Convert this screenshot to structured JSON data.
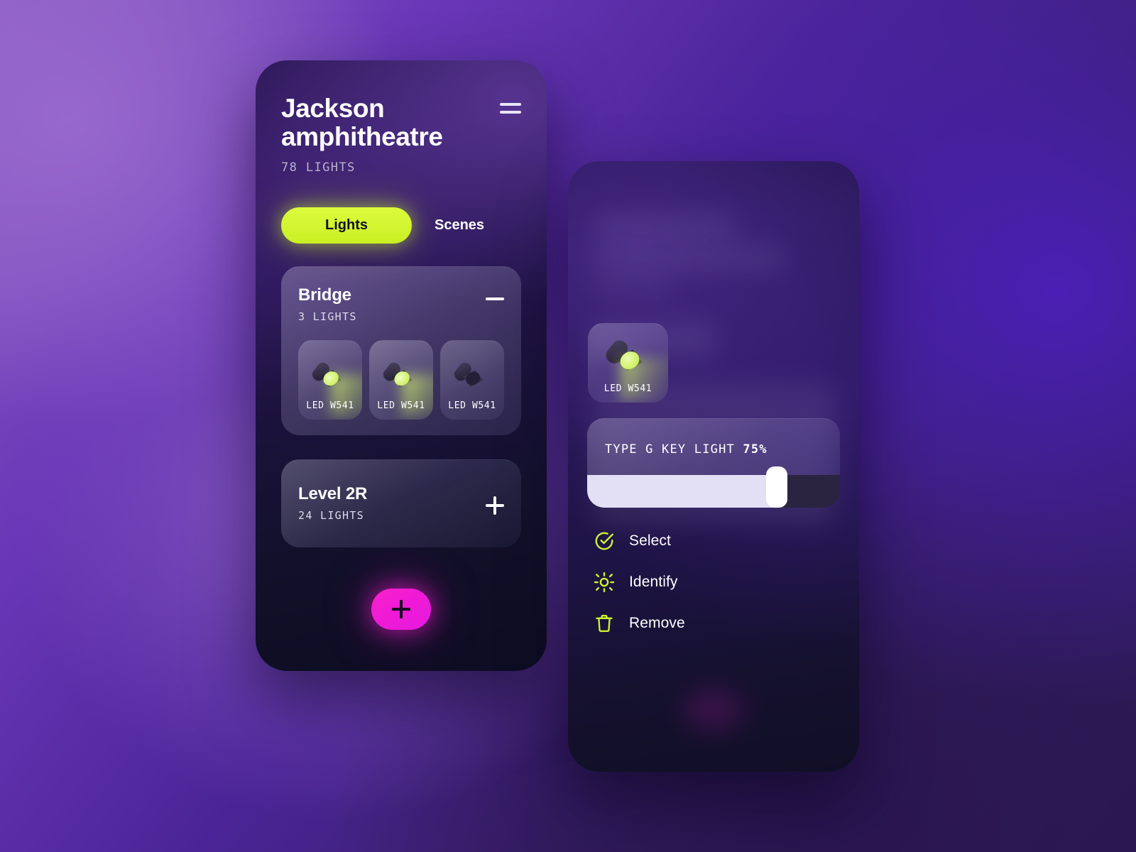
{
  "theme": {
    "lime": "#D4F72E",
    "magenta": "#F41ACF",
    "panel_dark": "#121233",
    "backdrop_light_purple": "#8D5FC0",
    "backdrop_dark_purple": "#2C1A55"
  },
  "left_phone": {
    "header": {
      "title": "Jackson amphitheatre",
      "subtitle": "78 LIGHTS",
      "menu_icon": "hamburger-icon"
    },
    "tabs": [
      {
        "label": "Lights",
        "active": true
      },
      {
        "label": "Scenes",
        "active": false
      }
    ],
    "groups": [
      {
        "name": "Bridge",
        "count_label": "3 LIGHTS",
        "toggle_icon": "minus-icon",
        "expanded": true,
        "lights": [
          {
            "label": "LED W541",
            "on": true
          },
          {
            "label": "LED W541",
            "on": true
          },
          {
            "label": "LED W541",
            "on": false
          }
        ]
      },
      {
        "name": "Level 2R",
        "count_label": "24 LIGHTS",
        "toggle_icon": "plus-icon",
        "expanded": false,
        "lights": []
      }
    ],
    "fab": {
      "icon": "plus-icon",
      "label": "Add"
    }
  },
  "right_phone": {
    "selected_light": {
      "label": "LED W541",
      "on": true
    },
    "slider": {
      "label": "TYPE G KEY LIGHT",
      "value_label": "75%",
      "value": 75,
      "min": 0,
      "max": 100
    },
    "actions": [
      {
        "label": "Select",
        "icon": "check-circle-icon"
      },
      {
        "label": "Identify",
        "icon": "brightness-sun-icon"
      },
      {
        "label": "Remove",
        "icon": "trash-icon"
      }
    ]
  }
}
